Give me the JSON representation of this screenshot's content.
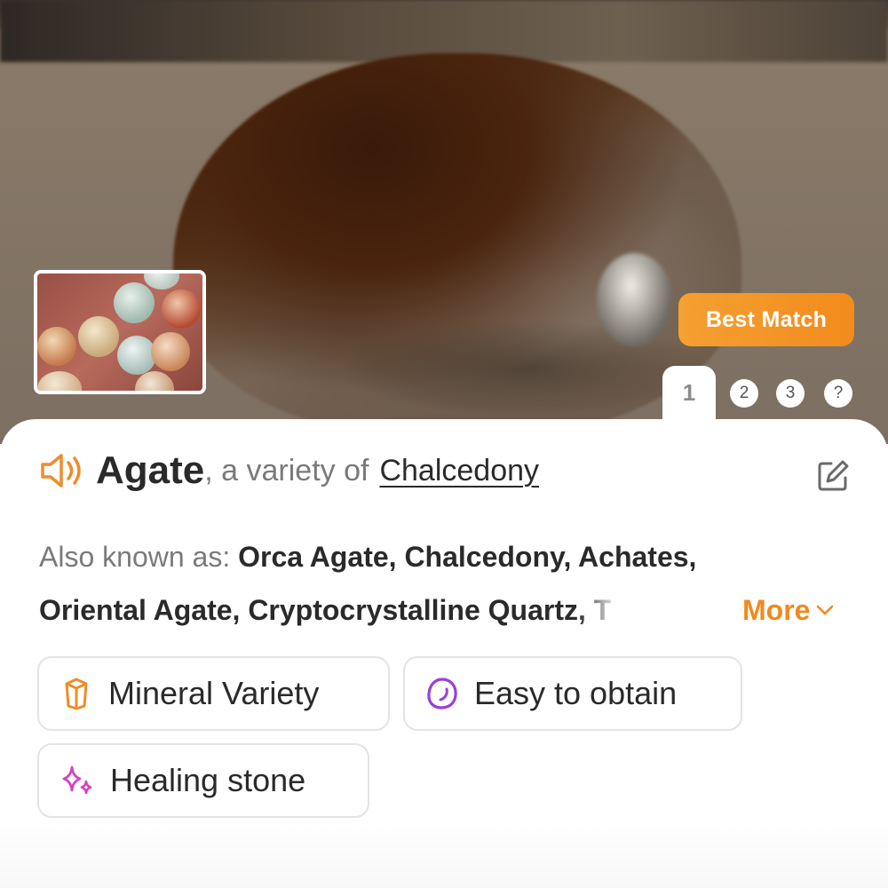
{
  "photo": {
    "badge": "Best Match",
    "tabs": [
      "1",
      "2",
      "3",
      "?"
    ],
    "active_tab": "1"
  },
  "title": {
    "name": "Agate",
    "connector": ", a variety of",
    "parent": "Chalcedony"
  },
  "aka": {
    "label": "Also known as:",
    "line1": "Orca Agate, Chalcedony, Achates,",
    "line2": "Oriental Agate, Cryptocrystalline Quartz, T",
    "more": "More"
  },
  "chips": [
    {
      "label": "Mineral Variety",
      "icon": "crystal-icon",
      "color": "#ef8c2a"
    },
    {
      "label": "Easy to obtain",
      "icon": "stone-icon",
      "color": "#9b3fd6"
    },
    {
      "label": "Healing stone",
      "icon": "sparkle-icon",
      "color": "#d63fc4"
    }
  ],
  "colors": {
    "accent": "#f08a1e",
    "badge": "#f28b1c"
  }
}
